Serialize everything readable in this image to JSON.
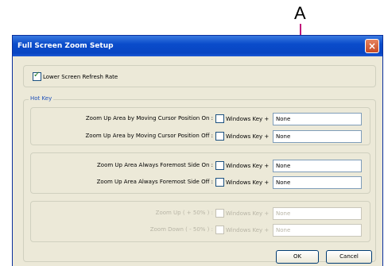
{
  "callout": {
    "letter": "A"
  },
  "window": {
    "title": "Full Screen Zoom Setup",
    "close_icon": "close-icon"
  },
  "options": {
    "lower_refresh_label": "Lower Screen Refresh Rate",
    "lower_refresh_checked": true
  },
  "hotkey": {
    "group_label": "Hot Key",
    "cursor_group": [
      {
        "label": "Zoom Up Area by Moving Cursor Position On :",
        "key_label": "Windows Key +",
        "checked": false,
        "value": "None"
      },
      {
        "label": "Zoom Up Area by Moving Cursor Position Off :",
        "key_label": "Windows Key +",
        "checked": false,
        "value": "None"
      }
    ],
    "foremost_group": [
      {
        "label": "Zoom Up Area Always Foremost Side On :",
        "key_label": "Windows Key +",
        "checked": false,
        "value": "None"
      },
      {
        "label": "Zoom Up Area Always Foremost Side Off :",
        "key_label": "Windows Key +",
        "checked": false,
        "value": "None"
      }
    ],
    "zoom_group": [
      {
        "label": "Zoom Up ( + 50% ) :",
        "key_label": "Windows Key +",
        "checked": false,
        "value": "None",
        "disabled": true
      },
      {
        "label": "Zoom Down ( - 50% ) :",
        "key_label": "Windows Key +",
        "checked": false,
        "value": "None",
        "disabled": true
      }
    ]
  },
  "buttons": {
    "ok": "OK",
    "cancel": "Cancel"
  }
}
